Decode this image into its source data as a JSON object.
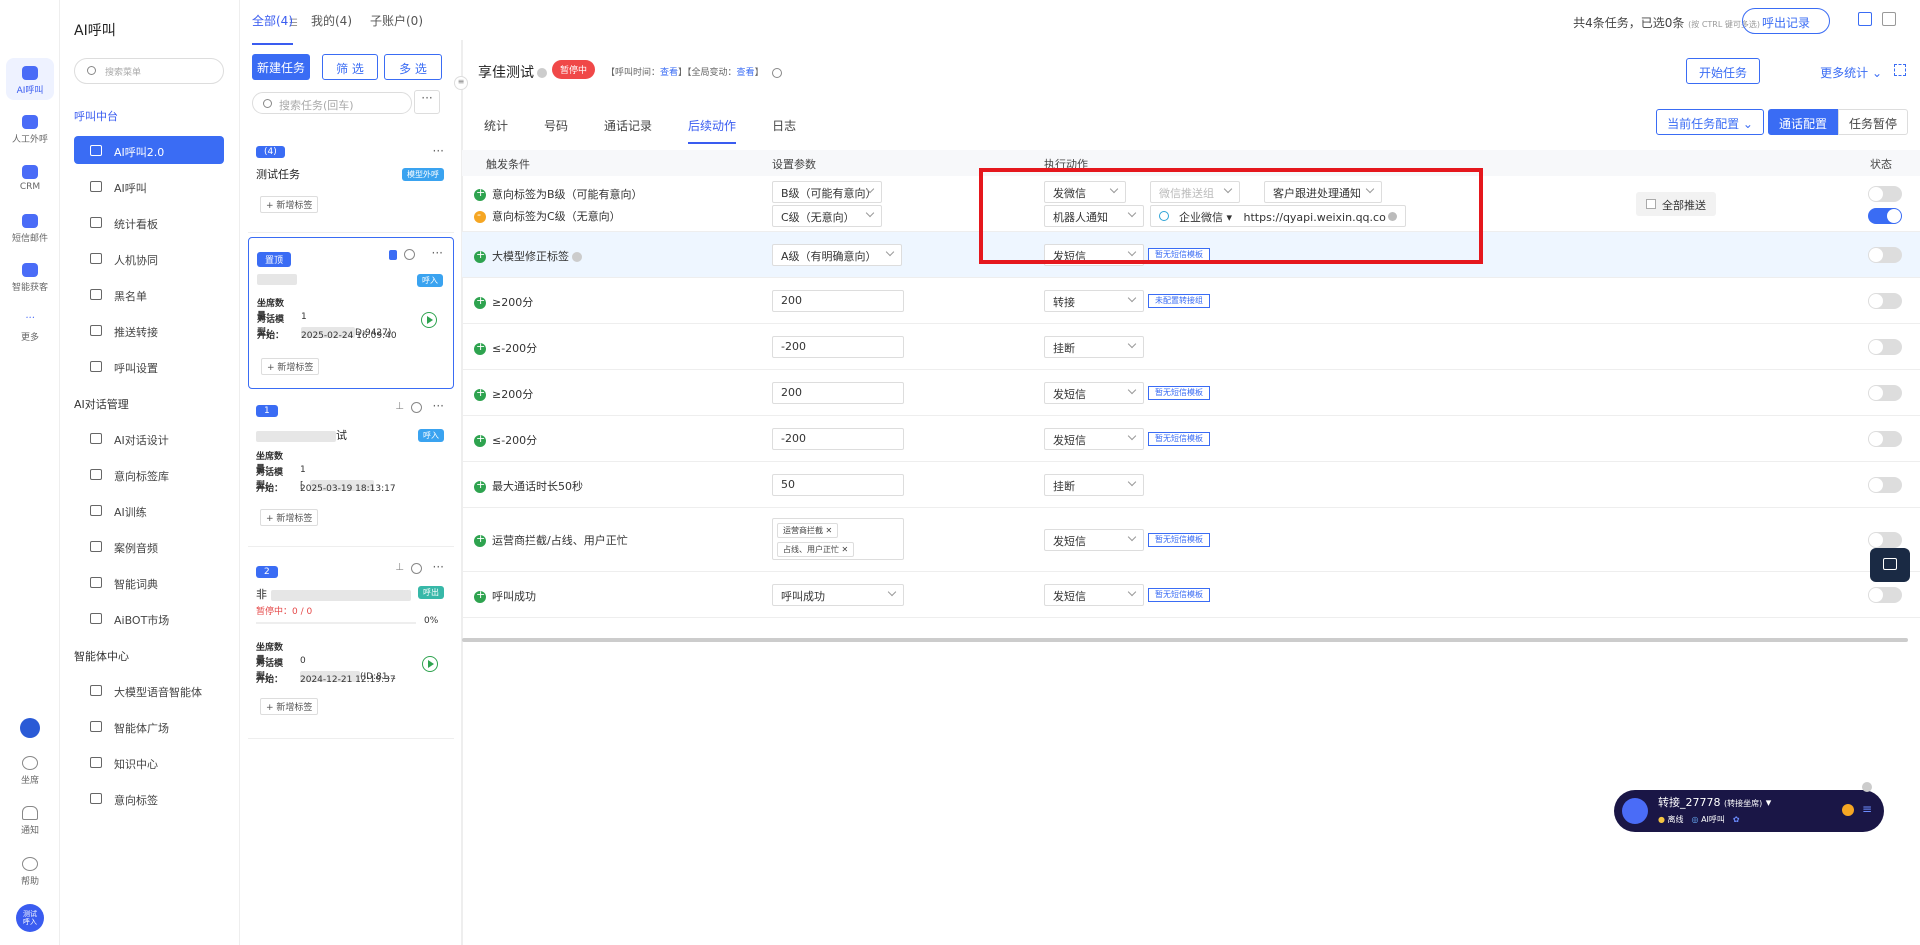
{
  "rail": {
    "items": [
      {
        "label": "AI呼叫",
        "icon": "ai-call-icon"
      },
      {
        "label": "人工外呼",
        "icon": "manual-call-icon"
      },
      {
        "label": "CRM",
        "icon": "crm-icon"
      },
      {
        "label": "短信邮件",
        "icon": "sms-mail-icon"
      },
      {
        "label": "智能获客",
        "icon": "acquire-icon"
      },
      {
        "label": "更多",
        "icon": "more-icon"
      }
    ],
    "bottom": [
      {
        "label": "坐席",
        "icon": "seat-icon"
      },
      {
        "label": "通知",
        "icon": "bell-icon"
      },
      {
        "label": "帮助",
        "icon": "help-icon"
      }
    ],
    "avatar": "测试\n呼入"
  },
  "nav": {
    "title": "AI呼叫",
    "search_placeholder": "搜索菜单",
    "group1": "呼叫中台",
    "items1": [
      "AI呼叫2.0",
      "AI呼叫",
      "统计看板",
      "人机协同",
      "黑名单",
      "推送转接",
      "呼叫设置"
    ],
    "group2": "AI对话管理",
    "items2": [
      "AI对话设计",
      "意向标签库",
      "AI训练",
      "案例音频",
      "智能词典",
      "AiBOT市场"
    ],
    "group3": "智能体中心",
    "items3": [
      "大模型语音智能体",
      "智能体广场",
      "知识中心",
      "意向标签"
    ]
  },
  "top": {
    "tabs": [
      "全部(4)",
      "我的(4)",
      "子账户(0)"
    ],
    "total": "共4条任务，已选0条",
    "hint": "(按 CTRL 键可多选)",
    "export": "呼出记录"
  },
  "tasks": {
    "new_btn": "新建任务",
    "filter_btn": "筛 选",
    "multi_btn": "多 选",
    "search_placeholder": "搜索任务(回车)",
    "more": "···",
    "add_tag": "+ 新增标签",
    "labels": {
      "seats": "坐席数量：",
      "model": "对话模型：",
      "start": "开始："
    },
    "cards": [
      {
        "num": "(4)",
        "title": "测试任务",
        "tag": "模型外呼"
      },
      {
        "num": "置顶",
        "title": "",
        "tag": "呼入",
        "seats": "1",
        "model": "D:9427)",
        "start": "2025-02-24 16:09:40"
      },
      {
        "num": "1",
        "title": "试",
        "tag": "呼入",
        "seats": "1",
        "model": "[",
        "start": "2025-03-19 18:13:17"
      },
      {
        "num": "2",
        "title": "非",
        "tag": "呼出",
        "status": "暂停中：0 / 0",
        "pct": "0%",
        "seats": "0",
        "model": "(ID:81...",
        "start": "2024-12-21 12:19:37"
      }
    ]
  },
  "main": {
    "title": "享佳测试",
    "status": "暂停中",
    "meta": [
      "【呼叫时间：",
      "查看",
      "】【全局变动：",
      "查看",
      "】"
    ],
    "start_btn": "开始任务",
    "more_stat": "更多统计",
    "tabs": [
      "统计",
      "号码",
      "通话记录",
      "后续动作",
      "日志"
    ],
    "cfg": [
      "当前任务配置",
      "通话配置",
      "任务暂停"
    ],
    "headers": [
      "触发条件",
      "设置参数",
      "执行动作",
      "状态"
    ],
    "push_all": "全部推送",
    "rows": [
      {
        "cond": "意向标签为B级（可能有意向）",
        "param": "B级（可能有意向）",
        "action": "发微信",
        "s2": "微信推送组",
        "s3": "客户跟进处理通知"
      },
      {
        "cond": "意向标签为C级（无意向）",
        "param": "C级（无意向）",
        "action": "机器人通知",
        "s2": "企业微信",
        "s3": "https://qyapi.weixin.qq.co"
      },
      {
        "cond": "大模型修正标签",
        "param": "A级（有明确意向）",
        "action": "发短信",
        "tmpl": "暂无短信模板"
      },
      {
        "cond": "≥200分",
        "param": "200",
        "action": "转接",
        "tmpl": "未配置转接组"
      },
      {
        "cond": "≤-200分",
        "param": "-200",
        "action": "挂断"
      },
      {
        "cond": "≥200分",
        "param": "200",
        "action": "发短信",
        "tmpl": "暂无短信模板"
      },
      {
        "cond": "≤-200分",
        "param": "-200",
        "action": "发短信",
        "tmpl": "暂无短信模板"
      },
      {
        "cond": "最大通话时长50秒",
        "param": "50",
        "action": "挂断"
      },
      {
        "cond": "运营商拦截/占线、用户正忙",
        "chips": [
          "运营商拦截",
          "占线、用户正忙"
        ],
        "action": "发短信",
        "tmpl": "暂无短信模板"
      },
      {
        "cond": "呼叫成功",
        "param": "呼叫成功",
        "action": "发短信",
        "tmpl": "暂无短信模板"
      }
    ]
  },
  "callbar": {
    "name": "转接_27778",
    "sub": "(转接坐席)",
    "status": "离线",
    "mode": "AI呼叫"
  }
}
